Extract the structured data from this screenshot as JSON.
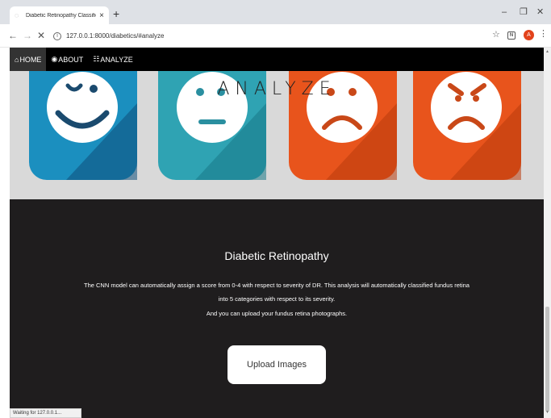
{
  "browser": {
    "tab_title": "Diabetic Retinopathy Classifier",
    "tab_close": "×",
    "new_tab": "+",
    "url": "127.0.0.1:8000/diabetics/#analyze",
    "avatar_letter": "A",
    "status_text": "Waiting for 127.0.0.1...",
    "icons": [
      "back-icon",
      "forward-icon",
      "stop-icon",
      "info-icon",
      "star-icon",
      "extension-icon",
      "menu-icon",
      "minimize-icon",
      "restore-icon",
      "close-window-icon"
    ]
  },
  "nav": {
    "items": [
      {
        "label": "HOME",
        "icon": "home-icon"
      },
      {
        "label": "ABOUT",
        "icon": "eye-icon"
      },
      {
        "label": "ANALYZE",
        "icon": "grid-icon"
      }
    ]
  },
  "hero": {
    "title": "ANALYZE",
    "emoji_tiles": [
      {
        "mood": "happy",
        "tile_color": "#1b8fbf"
      },
      {
        "mood": "neutral",
        "tile_color": "#2fa3b3"
      },
      {
        "mood": "sad",
        "tile_color": "#e8541c"
      },
      {
        "mood": "angry",
        "tile_color": "#e8541c"
      }
    ]
  },
  "main": {
    "section_title": "Diabetic Retinopathy",
    "desc_line1": "The CNN model can automatically assign a score from 0-4 with respect to severity of DR. This analysis will automatically classified fundus retina",
    "desc_line2": "into 5 categories with respect to its severity.",
    "desc_line3": "And you can upload your fundus retina photographs.",
    "upload_label": "Upload Images"
  },
  "colors": {
    "navbar": "#000000",
    "content_bg": "#1f1d1e",
    "hero_bg": "#d9d9d9",
    "avatar": "#e2421b"
  }
}
